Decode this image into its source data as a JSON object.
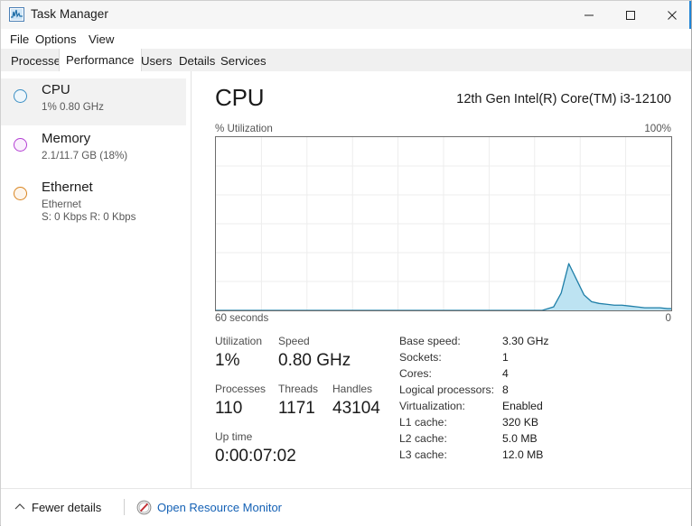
{
  "window": {
    "title": "Task Manager",
    "icon": "chart-icon",
    "controls": {
      "minimize": "minimize-icon",
      "maximize": "maximize-icon",
      "close": "close-icon"
    }
  },
  "menubar": {
    "items": [
      {
        "label": "File"
      },
      {
        "label": "Options"
      },
      {
        "label": "View"
      }
    ]
  },
  "tabs": {
    "active": "Performance",
    "items": [
      {
        "label": "Processes"
      },
      {
        "label": "Performance"
      },
      {
        "label": "Users"
      },
      {
        "label": "Details"
      },
      {
        "label": "Services"
      }
    ]
  },
  "sidebar": {
    "items": [
      {
        "name": "CPU",
        "sub1": "1%  0.80 GHz",
        "sub2": "",
        "color": "#3b8fc4",
        "selected": true
      },
      {
        "name": "Memory",
        "sub1": "2.1/11.7 GB (18%)",
        "sub2": "",
        "color": "#b43fd4",
        "selected": false
      },
      {
        "name": "Ethernet",
        "sub1": "Ethernet",
        "sub2": "S: 0 Kbps R: 0 Kbps",
        "color": "#d98521",
        "selected": false
      }
    ]
  },
  "main": {
    "heading": "CPU",
    "model": "12th Gen Intel(R) Core(TM) i3-12100",
    "graph_axis": {
      "y_label": "% Utilization",
      "y_max": "100%",
      "x_left": "60 seconds",
      "x_right": "0"
    },
    "stats": [
      {
        "label": "Utilization",
        "value": "1%"
      },
      {
        "label": "Speed",
        "value": "0.80 GHz"
      },
      {
        "label": "Processes",
        "value": "110"
      },
      {
        "label": "Threads",
        "value": "1171"
      },
      {
        "label": "Handles",
        "value": "43104"
      },
      {
        "label": "Up time",
        "value": "0:00:07:02"
      }
    ],
    "specs": [
      {
        "key": "Base speed:",
        "value": "3.30 GHz"
      },
      {
        "key": "Sockets:",
        "value": "1"
      },
      {
        "key": "Cores:",
        "value": "4"
      },
      {
        "key": "Logical processors:",
        "value": "8"
      },
      {
        "key": "Virtualization:",
        "value": "Enabled"
      },
      {
        "key": "L1 cache:",
        "value": "320 KB"
      },
      {
        "key": "L2 cache:",
        "value": "5.0 MB"
      },
      {
        "key": "L3 cache:",
        "value": "12.0 MB"
      }
    ]
  },
  "statusbar": {
    "fewer_details": "Fewer details",
    "resource_monitor": "Open Resource Monitor",
    "chevron": "chevron-up-icon",
    "resmon_icon": "resource-monitor-icon"
  },
  "colors": {
    "accent": "#1f84d6",
    "graph_line": "#1f7fa8",
    "graph_fill": "#bde3f2",
    "link": "#1461b5"
  },
  "chart_data": {
    "type": "area",
    "title": "% Utilization",
    "xlabel": "60 seconds",
    "ylabel": "% Utilization",
    "ylim": [
      0,
      100
    ],
    "xlim": [
      60,
      0
    ],
    "grid": true,
    "grid_cols": 10,
    "grid_rows": 6,
    "series": [
      {
        "name": "CPU utilization",
        "line_color": "#1f7fa8",
        "fill_color": "#bde3f2",
        "x": [
          60,
          54,
          48,
          42,
          36,
          30,
          24,
          20,
          17,
          15.5,
          14.5,
          13.5,
          12.5,
          11.5,
          10.5,
          9.5,
          8.5,
          7.5,
          6.5,
          5.5,
          4.5,
          3.5,
          2.5,
          1.5,
          0.5,
          0
        ],
        "y": [
          0,
          0,
          0,
          0,
          0,
          0,
          0,
          0,
          0,
          2,
          10,
          27,
          18,
          9,
          5,
          4,
          3.5,
          3,
          3,
          2.5,
          2,
          1.5,
          1.5,
          1.5,
          1,
          1
        ]
      }
    ]
  }
}
